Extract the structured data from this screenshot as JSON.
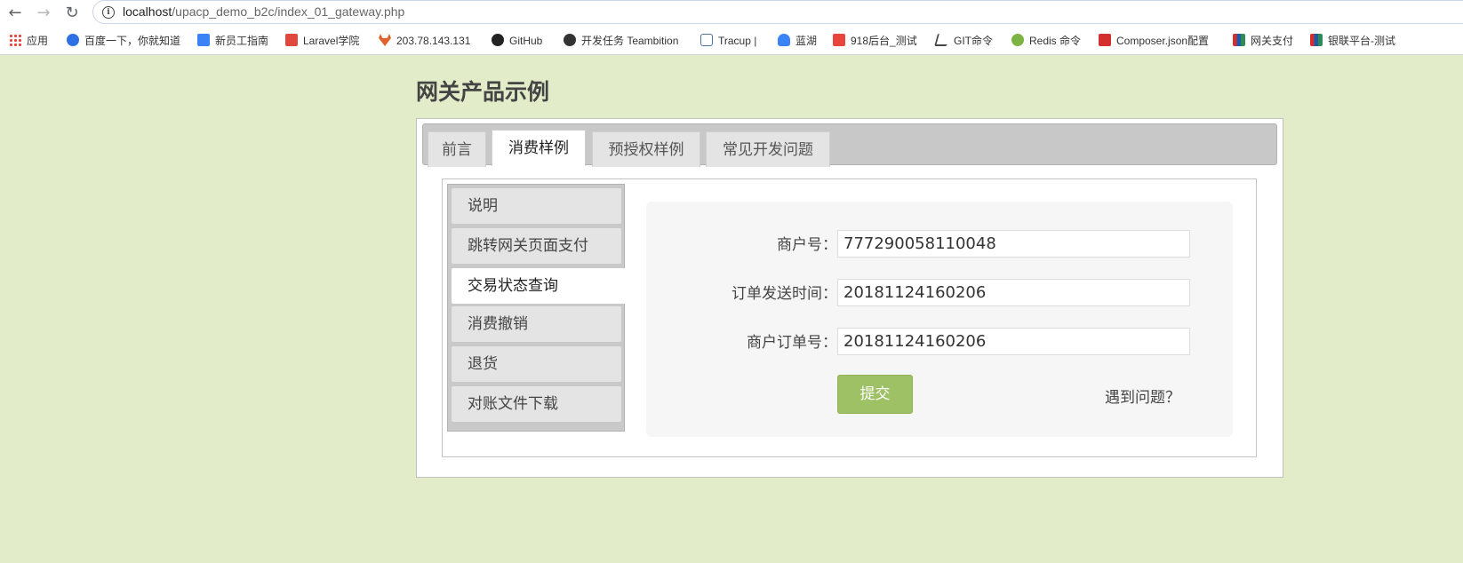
{
  "browser": {
    "url_host": "localhost",
    "url_path": "/upacp_demo_b2c/index_01_gateway.php",
    "bookmarks": [
      {
        "label": "应用",
        "icon": "apps-icon"
      },
      {
        "label": "百度一下，你就知道",
        "icon": "baidu-paw-icon",
        "color": "#2f6fe4"
      },
      {
        "label": "新员工指南",
        "icon": "note-icon",
        "color": "#3b82f6"
      },
      {
        "label": "Laravel学院",
        "icon": "laravel-icon",
        "color": "#e0483e"
      },
      {
        "label": "203.78.143.131",
        "icon": "gitlab-icon",
        "color": "#e2622b"
      },
      {
        "label": "GitHub",
        "icon": "github-icon",
        "color": "#222222"
      },
      {
        "label": "开发任务 Teambition",
        "icon": "teambition-icon",
        "color": "#333333"
      },
      {
        "label": "Tracup |",
        "icon": "tracup-icon",
        "color": "#4a6fa5"
      },
      {
        "label": "蓝湖",
        "icon": "lanhu-icon",
        "color": "#3b82f6"
      },
      {
        "label": "918后台_测试",
        "icon": "qb-icon",
        "color": "#e8453c"
      },
      {
        "label": "GIT命令",
        "icon": "git-icon",
        "color": "#444444"
      },
      {
        "label": "Redis 命令",
        "icon": "redis-icon",
        "color": "#7cb342"
      },
      {
        "label": "Composer.json配置",
        "icon": "composer-icon",
        "color": "#d32f2f"
      },
      {
        "label": "网关支付",
        "icon": "unionpay-icon",
        "color": "#1e5aa8"
      },
      {
        "label": "银联平台-测试",
        "icon": "unionpay-icon",
        "color": "#1e5aa8"
      }
    ]
  },
  "page": {
    "title": "网关产品示例",
    "tabs": [
      {
        "label": "前言"
      },
      {
        "label": "消费样例"
      },
      {
        "label": "预授权样例"
      },
      {
        "label": "常见开发问题"
      }
    ],
    "active_tab": "消费样例",
    "side_menu": [
      {
        "label": "说明"
      },
      {
        "label": "跳转网关页面支付"
      },
      {
        "label": "交易状态查询"
      },
      {
        "label": "消费撤销"
      },
      {
        "label": "退货"
      },
      {
        "label": "对账文件下载"
      }
    ],
    "active_side": "交易状态查询",
    "form": {
      "merchant_id_label": "商户号：",
      "merchant_id_value": "777290058110048",
      "order_time_label": "订单发送时间：",
      "order_time_value": "20181124160206",
      "order_id_label": "商户订单号：",
      "order_id_value": "20181124160206",
      "submit_label": "提交",
      "help_label": "遇到问题？"
    }
  },
  "colors": {
    "page_bg": "#e3ecc9",
    "submit_bg": "#9dc164"
  }
}
